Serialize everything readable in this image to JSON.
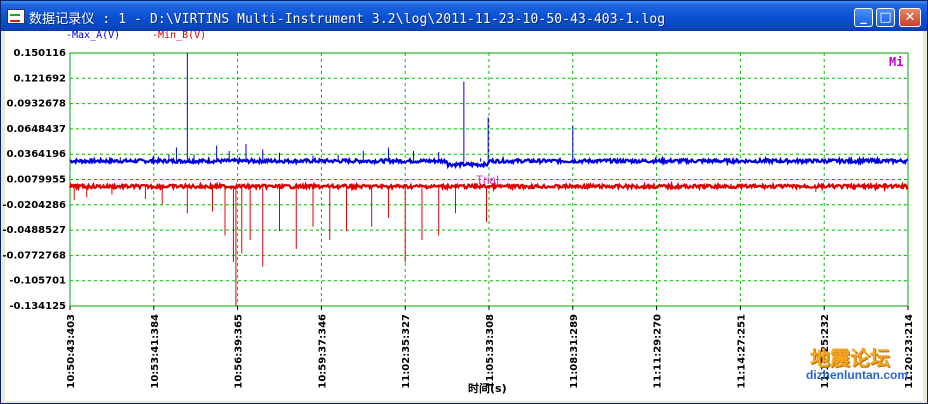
{
  "window": {
    "title": "数据记录仪 : 1 - D:\\VIRTINS Multi-Instrument 3.2\\log\\2011-11-23-10-50-43-403-1.log",
    "minimize_label": "_",
    "maximize_label": "□",
    "close_label": "✕",
    "icon": "chart-app-icon"
  },
  "overlay": {
    "trial_text": "Trial",
    "corner_text": "Mi",
    "watermark_cn": "地震论坛",
    "watermark_url": "dizhenluntan.com"
  },
  "colors": {
    "series_a": "#0000dd",
    "series_b": "#dd0000",
    "grid": "#00bb00",
    "plot_border": "#00aa00",
    "background": "#ffffff"
  },
  "chart_data": {
    "type": "line",
    "xlabel": "时间(s)",
    "ylabel": "",
    "title": "",
    "grid": true,
    "legend_placement": "top-left",
    "yticks": [
      "0.150116",
      "0.121692",
      "0.0932678",
      "0.0648437",
      "0.0364196",
      "0.0079955",
      "-0.0204286",
      "-0.0488527",
      "-0.0772768",
      "-0.105701",
      "-0.134125"
    ],
    "ylim": [
      -0.134125,
      0.150116
    ],
    "xticks": [
      "10:50:43:403",
      "10:53:41:384",
      "10:56:39:365",
      "10:59:37:346",
      "11:02:35:327",
      "11:05:33:308",
      "11:08:31:289",
      "11:11:29:270",
      "11:14:27:251",
      "11:17:25:232",
      "11:20:23:214"
    ],
    "series": [
      {
        "name": "-Max_A(V)",
        "baseline": 0.028,
        "spikes": [
          [
            0.06,
            0.033
          ],
          [
            0.1,
            0.034
          ],
          [
            0.118,
            0.036
          ],
          [
            0.127,
            0.044
          ],
          [
            0.14,
            0.15
          ],
          [
            0.148,
            0.036
          ],
          [
            0.175,
            0.046
          ],
          [
            0.19,
            0.04
          ],
          [
            0.21,
            0.048
          ],
          [
            0.23,
            0.042
          ],
          [
            0.25,
            0.038
          ],
          [
            0.29,
            0.035
          ],
          [
            0.32,
            0.036
          ],
          [
            0.35,
            0.04
          ],
          [
            0.38,
            0.044
          ],
          [
            0.41,
            0.04
          ],
          [
            0.44,
            0.039
          ],
          [
            0.47,
            0.118
          ],
          [
            0.49,
            0.032
          ],
          [
            0.499,
            0.078
          ],
          [
            0.6,
            0.068
          ],
          [
            0.83,
            0.034
          ]
        ]
      },
      {
        "name": "-Min_B(V)",
        "baseline": 0.001,
        "spikes": [
          [
            0.005,
            -0.015
          ],
          [
            0.02,
            -0.012
          ],
          [
            0.05,
            -0.009
          ],
          [
            0.09,
            -0.014
          ],
          [
            0.11,
            -0.02
          ],
          [
            0.14,
            -0.03
          ],
          [
            0.17,
            -0.028
          ],
          [
            0.185,
            -0.055
          ],
          [
            0.195,
            -0.085
          ],
          [
            0.198,
            -0.134
          ],
          [
            0.205,
            -0.075
          ],
          [
            0.215,
            -0.06
          ],
          [
            0.23,
            -0.09
          ],
          [
            0.25,
            -0.05
          ],
          [
            0.27,
            -0.07
          ],
          [
            0.29,
            -0.045
          ],
          [
            0.31,
            -0.06
          ],
          [
            0.33,
            -0.05
          ],
          [
            0.36,
            -0.045
          ],
          [
            0.38,
            -0.035
          ],
          [
            0.4,
            -0.085
          ],
          [
            0.42,
            -0.06
          ],
          [
            0.44,
            -0.055
          ],
          [
            0.46,
            -0.03
          ],
          [
            0.497,
            -0.04
          ],
          [
            0.89,
            -0.006
          ]
        ]
      }
    ]
  }
}
